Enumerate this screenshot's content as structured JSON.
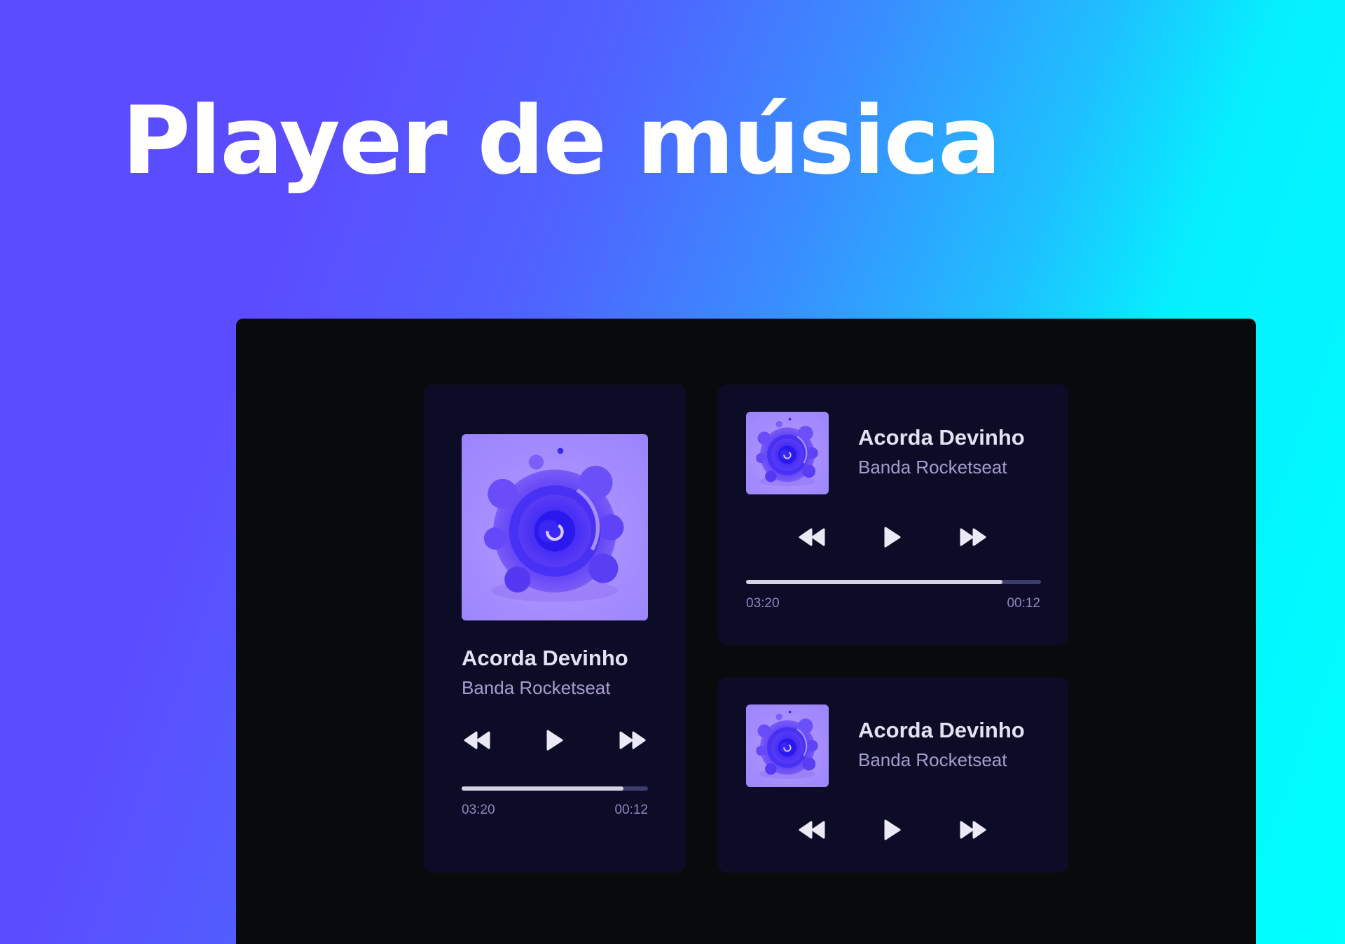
{
  "page": {
    "title": "Player de música"
  },
  "colors": {
    "background_gradient": [
      "#5a4cff",
      "#00ffff"
    ],
    "window": "#090a0c",
    "card": "#0d0c26",
    "title_text": "#e4e2f2",
    "artist_text": "#a89ccf",
    "progress_track": "#3c3d6e",
    "progress_fill": "#d4d3e4",
    "cover": "#a48cff"
  },
  "players": {
    "large": {
      "cover_icon": "abstract-purple-swirl-art",
      "title": "Acorda Devinho",
      "artist": "Banda Rocketseat",
      "controls": [
        "rewind-icon",
        "play-icon",
        "fast-forward-icon"
      ],
      "progress": 0.87,
      "time_total": "03:20",
      "time_elapsed": "00:12"
    },
    "medium": {
      "cover_icon": "abstract-purple-swirl-art",
      "title": "Acorda Devinho",
      "artist": "Banda Rocketseat",
      "controls": [
        "rewind-icon",
        "play-icon",
        "fast-forward-icon"
      ],
      "progress": 0.87,
      "time_total": "03:20",
      "time_elapsed": "00:12"
    },
    "small": {
      "cover_icon": "abstract-purple-swirl-art",
      "title": "Acorda Devinho",
      "artist": "Banda Rocketseat",
      "controls": [
        "rewind-icon",
        "play-icon",
        "fast-forward-icon"
      ]
    }
  }
}
